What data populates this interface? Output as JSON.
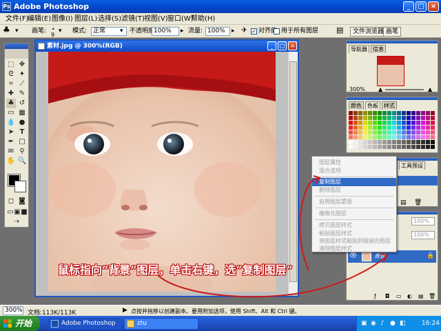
{
  "window": {
    "title": "Adobe Photoshop",
    "icon": "Ps"
  },
  "menu": [
    "文件(F)",
    "编辑(E)",
    "图像(I)",
    "图层(L)",
    "选择(S)",
    "滤镜(T)",
    "视图(V)",
    "窗口(W)",
    "帮助(H)"
  ],
  "options": {
    "brush_label": "画笔:",
    "brush_size": "9",
    "mode_label": "模式:",
    "mode_value": "正常",
    "opacity_label": "不透明度:",
    "opacity_value": "100%",
    "flow_label": "流量:",
    "flow_value": "100%",
    "aligned_label": "对齐的",
    "all_layers_label": "用于所有图层",
    "palette_tabs": [
      "文件浏览器",
      "画笔"
    ]
  },
  "document": {
    "title": "素材.jpg @ 300%(RGB)"
  },
  "panels": {
    "navigator": {
      "tabs": [
        "导航器",
        "信息"
      ],
      "zoom": "300%"
    },
    "swatches": {
      "tabs": [
        "颜色",
        "色板",
        "样式"
      ]
    },
    "history": {
      "tabs": [
        "工具预设"
      ]
    },
    "layers": {
      "opacity": "100%",
      "fill": "100%",
      "layer_name": "背景"
    }
  },
  "context_menu": {
    "items": [
      "图层属性",
      "混合选项",
      "复制图层",
      "删除图层",
      "启用图层蒙版",
      "栅格化图层",
      "拷贝图层样式",
      "粘贴图层样式",
      "将图层样式粘贴到链接的图层",
      "清除图层样式"
    ],
    "highlighted": "复制图层"
  },
  "annotation": "鼠标指向“背景”图层，单击右键，选“复制图层”",
  "status": {
    "zoom": "300%",
    "doc_info": "文档:113K/113K",
    "hint": "点按并拖移以创建副本。要用附加选项，使用 Shift、Alt 和 Ctrl 键。"
  },
  "taskbar": {
    "start": "开始",
    "tasks": [
      "Adobe Photoshop",
      "ztu"
    ],
    "time": "16:24"
  },
  "colors": {
    "titlebar": "#0346c9",
    "taskbar": "#245edb",
    "start": "#2b8a2b",
    "highlight": "#316ac5",
    "annotation": "#ffffff",
    "annotation_outline": "#bb0000",
    "arrow": "#cc1b1b"
  }
}
